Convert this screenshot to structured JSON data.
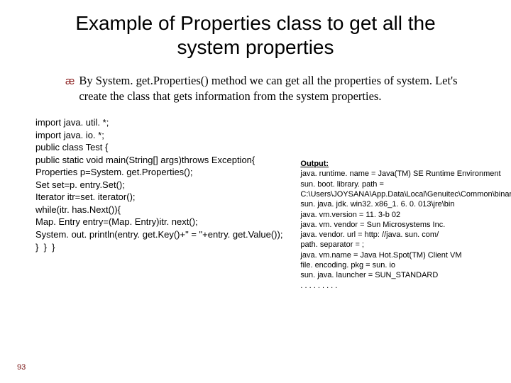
{
  "title": "Example of Properties class to get all the system properties",
  "bullet": "By System. get.Properties() method we can get all the properties of system. Let's create the class that gets information from the system properties.",
  "code": [
    "import java. util. *;",
    "import java. io. *;",
    "public class Test {",
    "public static void main(String[] args)throws Exception{",
    "Properties p=System. get.Properties();",
    "Set set=p. entry.Set();",
    "Iterator itr=set. iterator();",
    "while(itr. has.Next()){",
    "Map. Entry entry=(Map. Entry)itr. next();",
    "System. out. println(entry. get.Key()+\" = \"+entry. get.Value());",
    "}  }  }"
  ],
  "output": {
    "heading": "Output:",
    "lines": [
      "java. runtime. name = Java(TM) SE Runtime Environment",
      "sun. boot. library. path = C:\\Users\\JOYSANA\\App.Data\\Local\\Genuitec\\Common\\binary\\com. sun. java. jdk. win32. x86_1. 6. 0. 013\\jre\\bin",
      "java. vm.version = 11. 3-b 02",
      "java. vm. vendor = Sun Microsystems Inc.",
      "java. vendor. url = http: //java. sun. com/",
      "path. separator = ;",
      "java. vm.name = Java Hot.Spot(TM) Client VM",
      "file. encoding. pkg = sun. io",
      "sun. java. launcher = SUN_STANDARD",
      ". . . . . . . . ."
    ]
  },
  "page_number": "93"
}
